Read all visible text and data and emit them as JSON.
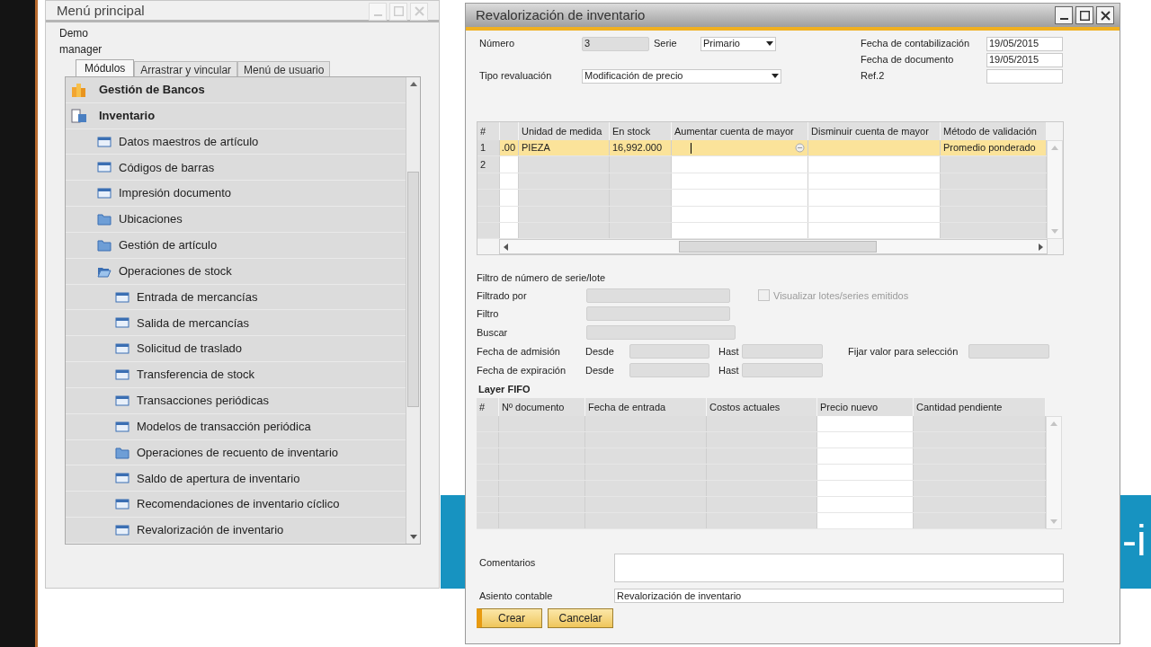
{
  "desktop": {
    "band_text": "-i"
  },
  "main_menu": {
    "title": "Menú principal",
    "company": "Demo",
    "user": "manager",
    "tabs": [
      {
        "label": "Módulos",
        "selected": true
      },
      {
        "label": "Arrastrar y vincular",
        "selected": false
      },
      {
        "label": "Menú de usuario",
        "selected": false
      }
    ],
    "items": [
      {
        "label": "Gestión de Bancos",
        "kind": "module"
      },
      {
        "label": "Inventario",
        "kind": "module",
        "children": [
          {
            "label": "Datos maestros de artículo",
            "kind": "form"
          },
          {
            "label": "Códigos de barras",
            "kind": "form"
          },
          {
            "label": "Impresión documento",
            "kind": "form"
          },
          {
            "label": "Ubicaciones",
            "kind": "folder",
            "expanded": false
          },
          {
            "label": "Gestión de artículo",
            "kind": "folder",
            "expanded": false
          },
          {
            "label": "Operaciones de stock",
            "kind": "folder",
            "expanded": true,
            "children": [
              {
                "label": "Entrada de mercancías",
                "kind": "form"
              },
              {
                "label": "Salida de mercancías",
                "kind": "form"
              },
              {
                "label": "Solicitud de traslado",
                "kind": "form"
              },
              {
                "label": "Transferencia de stock",
                "kind": "form"
              },
              {
                "label": "Transacciones periódicas",
                "kind": "form"
              },
              {
                "label": "Modelos de transacción periódica",
                "kind": "form"
              },
              {
                "label": "Operaciones de recuento de inventario",
                "kind": "folder",
                "expanded": false
              },
              {
                "label": "Saldo de apertura de inventario",
                "kind": "form"
              },
              {
                "label": "Recomendaciones de inventario cíclico",
                "kind": "form"
              },
              {
                "label": "Revalorización de inventario",
                "kind": "form"
              }
            ]
          }
        ]
      }
    ]
  },
  "revaluation": {
    "title": "Revalorización de inventario",
    "number": {
      "label": "Número",
      "value": "3"
    },
    "series": {
      "label": "Serie",
      "value": "Primario"
    },
    "type": {
      "label": "Tipo revaluación",
      "value": "Modificación de precio"
    },
    "posting_date": {
      "label": "Fecha de contabilización",
      "value": "19/05/2015"
    },
    "document_date": {
      "label": "Fecha de documento",
      "value": "19/05/2015"
    },
    "ref2": {
      "label": "Ref.2"
    },
    "lines": {
      "columns": [
        "#",
        "Unidad de medida",
        "En stock",
        "Aumentar cuenta de mayor",
        "Disminuir cuenta de mayor",
        "Método de validación"
      ],
      "rows": [
        {
          "num": "1",
          "column_2": ".00",
          "unit": "PIEZA",
          "stock": "16,992.000",
          "method": "Promedio ponderado",
          "selected": true
        },
        {
          "num": "2",
          "selected": false
        }
      ]
    },
    "filter": {
      "title": "Filtro de número de serie/lote",
      "filtered_by": "Filtrado por",
      "filter": "Filtro",
      "search": "Buscar",
      "show_issued": {
        "label": "Visualizar lotes/series emitidos",
        "checked": false,
        "disabled": true
      },
      "admission": {
        "label": "Fecha de admisión",
        "from": "Desde",
        "to": "Hast"
      },
      "expiration": {
        "label": "Fecha de expiración",
        "from": "Desde",
        "to": "Hast"
      },
      "set_value": "Fijar valor para selección"
    },
    "fifo": {
      "title": "Layer FIFO",
      "columns": [
        "#",
        "Nº documento",
        "Fecha de entrada",
        "Costos actuales",
        "Precio nuevo",
        "Cantidad pendiente"
      ]
    },
    "comments": {
      "label": "Comentarios"
    },
    "journal": {
      "label": "Asiento contable",
      "value": "Revalorización de inventario"
    },
    "buttons": [
      {
        "label": "Crear",
        "default": true
      },
      {
        "label": "Cancelar",
        "default": false
      }
    ]
  }
}
